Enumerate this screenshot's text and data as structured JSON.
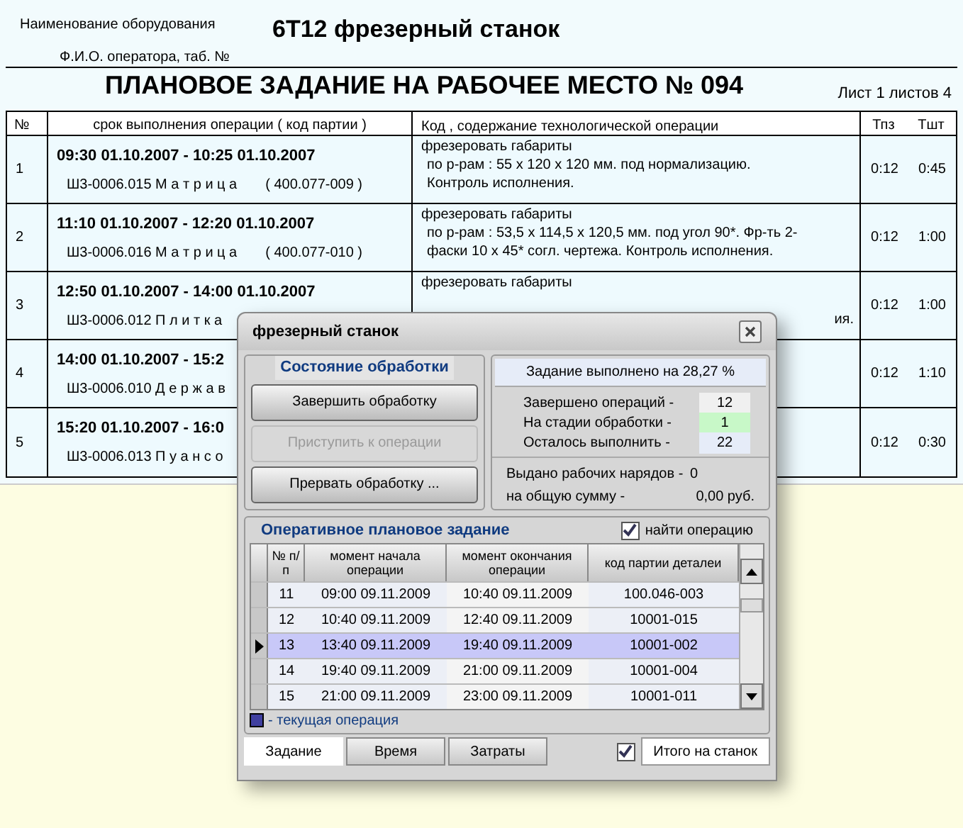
{
  "header": {
    "equipment_label": "Наименование оборудования",
    "operator_label": "Ф.И.О. оператора, таб. №",
    "equipment_name": "6Т12  фрезерный станок",
    "title": "ПЛАНОВОЕ ЗАДАНИЕ НА РАБОЧЕЕ МЕСТО  № 094",
    "sheet": "Лист 1  листов 4"
  },
  "table": {
    "columns": [
      "№",
      "срок выполнения операции  ( код партии )",
      "Код , содержание технологической операции",
      "Тпз",
      "Тшт"
    ],
    "rows": [
      {
        "num": "1",
        "period": "09:30  01.10.2007 - 10:25  01.10.2007",
        "part": "Ш3-0006.015 М а т р и ц а",
        "batch": "( 400.077-009 )",
        "description": [
          "фрезеровать габариты",
          "по р-рам : 55 х 120 х 120 мм. под нормализацию.",
          "Контроль исполнения."
        ],
        "tpz": "0:12",
        "tsht": "0:45"
      },
      {
        "num": "2",
        "period": "11:10  01.10.2007 - 12:20  01.10.2007",
        "part": "Ш3-0006.016 М а т р и ц а",
        "batch": "( 400.077-010 )",
        "description": [
          "фрезеровать габариты",
          "по р-рам : 53,5 х 114,5 х 120,5 мм. под угол 90*. Фр-ть 2-",
          "фаски 10 х 45* согл. чертежа.  Контроль исполнения."
        ],
        "tpz": "0:12",
        "tsht": "1:00"
      },
      {
        "num": "3",
        "period": "12:50  01.10.2007 - 14:00  01.10.2007",
        "part": "Ш3-0006.012 П л и т к а",
        "description": [
          "фрезеровать габариты"
        ],
        "tail": "ия.",
        "tpz": "0:12",
        "tsht": "1:00"
      },
      {
        "num": "4",
        "period": "14:00  01.10.2007 - 15:2",
        "part": "Ш3-0006.010 Д е р ж а в",
        "tpz": "0:12",
        "tsht": "1:10"
      },
      {
        "num": "5",
        "period": "15:20  01.10.2007 - 16:0",
        "part": "Ш3-0006.013 П у а н с о",
        "tpz": "0:12",
        "tsht": "0:30"
      }
    ]
  },
  "dialog": {
    "title": "фрезерный станок",
    "state_group": {
      "title": "Состояние обработки",
      "buttons": [
        {
          "label": "Завершить обработку",
          "disabled": false
        },
        {
          "label": "Приступить к операции",
          "disabled": true
        },
        {
          "label": "Прервать обработку ...",
          "disabled": false
        }
      ]
    },
    "progress": "Задание выполнено на 28,27 %",
    "counters": [
      {
        "label": "Завершено операций  -",
        "value": "12",
        "color": "#f0f0f0"
      },
      {
        "label": "На стадии обработки  -",
        "value": "1",
        "color": "#c8f8c8"
      },
      {
        "label": "Осталось выполнить -",
        "value": "22",
        "color": "#e6ecf8"
      }
    ],
    "issued": [
      {
        "label": "Выдано рабочих нарядов  -",
        "value": "0"
      },
      {
        "label": "на общую сумму  -",
        "value": "0,00 руб."
      }
    ],
    "plan_group": {
      "title": "Оперативное плановое задание",
      "find": {
        "label": "найти операцию",
        "checked": true
      },
      "columns": [
        "№ п/п",
        "момент начала операции",
        "момент окончания операции",
        "код партии деталеи"
      ],
      "rows": [
        {
          "num": "11",
          "start": "09:00  09.11.2009",
          "end": "10:40  09.11.2009",
          "code": "100.046-003",
          "selected": false
        },
        {
          "num": "12",
          "start": "10:40  09.11.2009",
          "end": "12:40  09.11.2009",
          "code": "10001-015",
          "selected": false
        },
        {
          "num": "13",
          "start": "13:40  09.11.2009",
          "end": "19:40  09.11.2009",
          "code": "10001-002",
          "selected": true
        },
        {
          "num": "14",
          "start": "19:40  09.11.2009",
          "end": "21:00  09.11.2009",
          "code": "10001-004",
          "selected": false
        },
        {
          "num": "15",
          "start": "21:00  09.11.2009",
          "end": "23:00  09.11.2009",
          "code": "10001-011",
          "selected": false
        }
      ],
      "legend": "- текущая операция"
    },
    "tabs": [
      {
        "label": "Задание",
        "selected": true
      },
      {
        "label": "Время",
        "selected": false
      },
      {
        "label": "Затраты",
        "selected": false
      }
    ],
    "total": {
      "label": "Итого на станок",
      "checked": true
    }
  }
}
